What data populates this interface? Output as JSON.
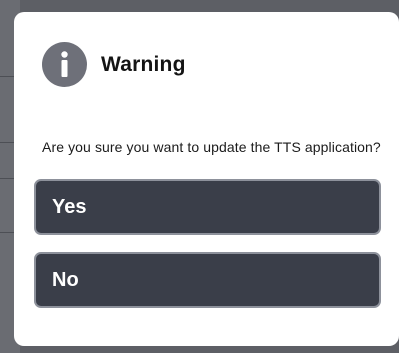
{
  "dialog": {
    "icon": "info-icon",
    "title": "Warning",
    "message": "Are you sure you want to update the TTS application?",
    "buttons": {
      "yes_label": "Yes",
      "no_label": "No"
    }
  },
  "colors": {
    "scrim": "#5d5f65",
    "dialog_bg": "#ffffff",
    "icon_bg": "#6e7079",
    "button_bg": "#3a3e49",
    "button_border": "#8d919b"
  }
}
